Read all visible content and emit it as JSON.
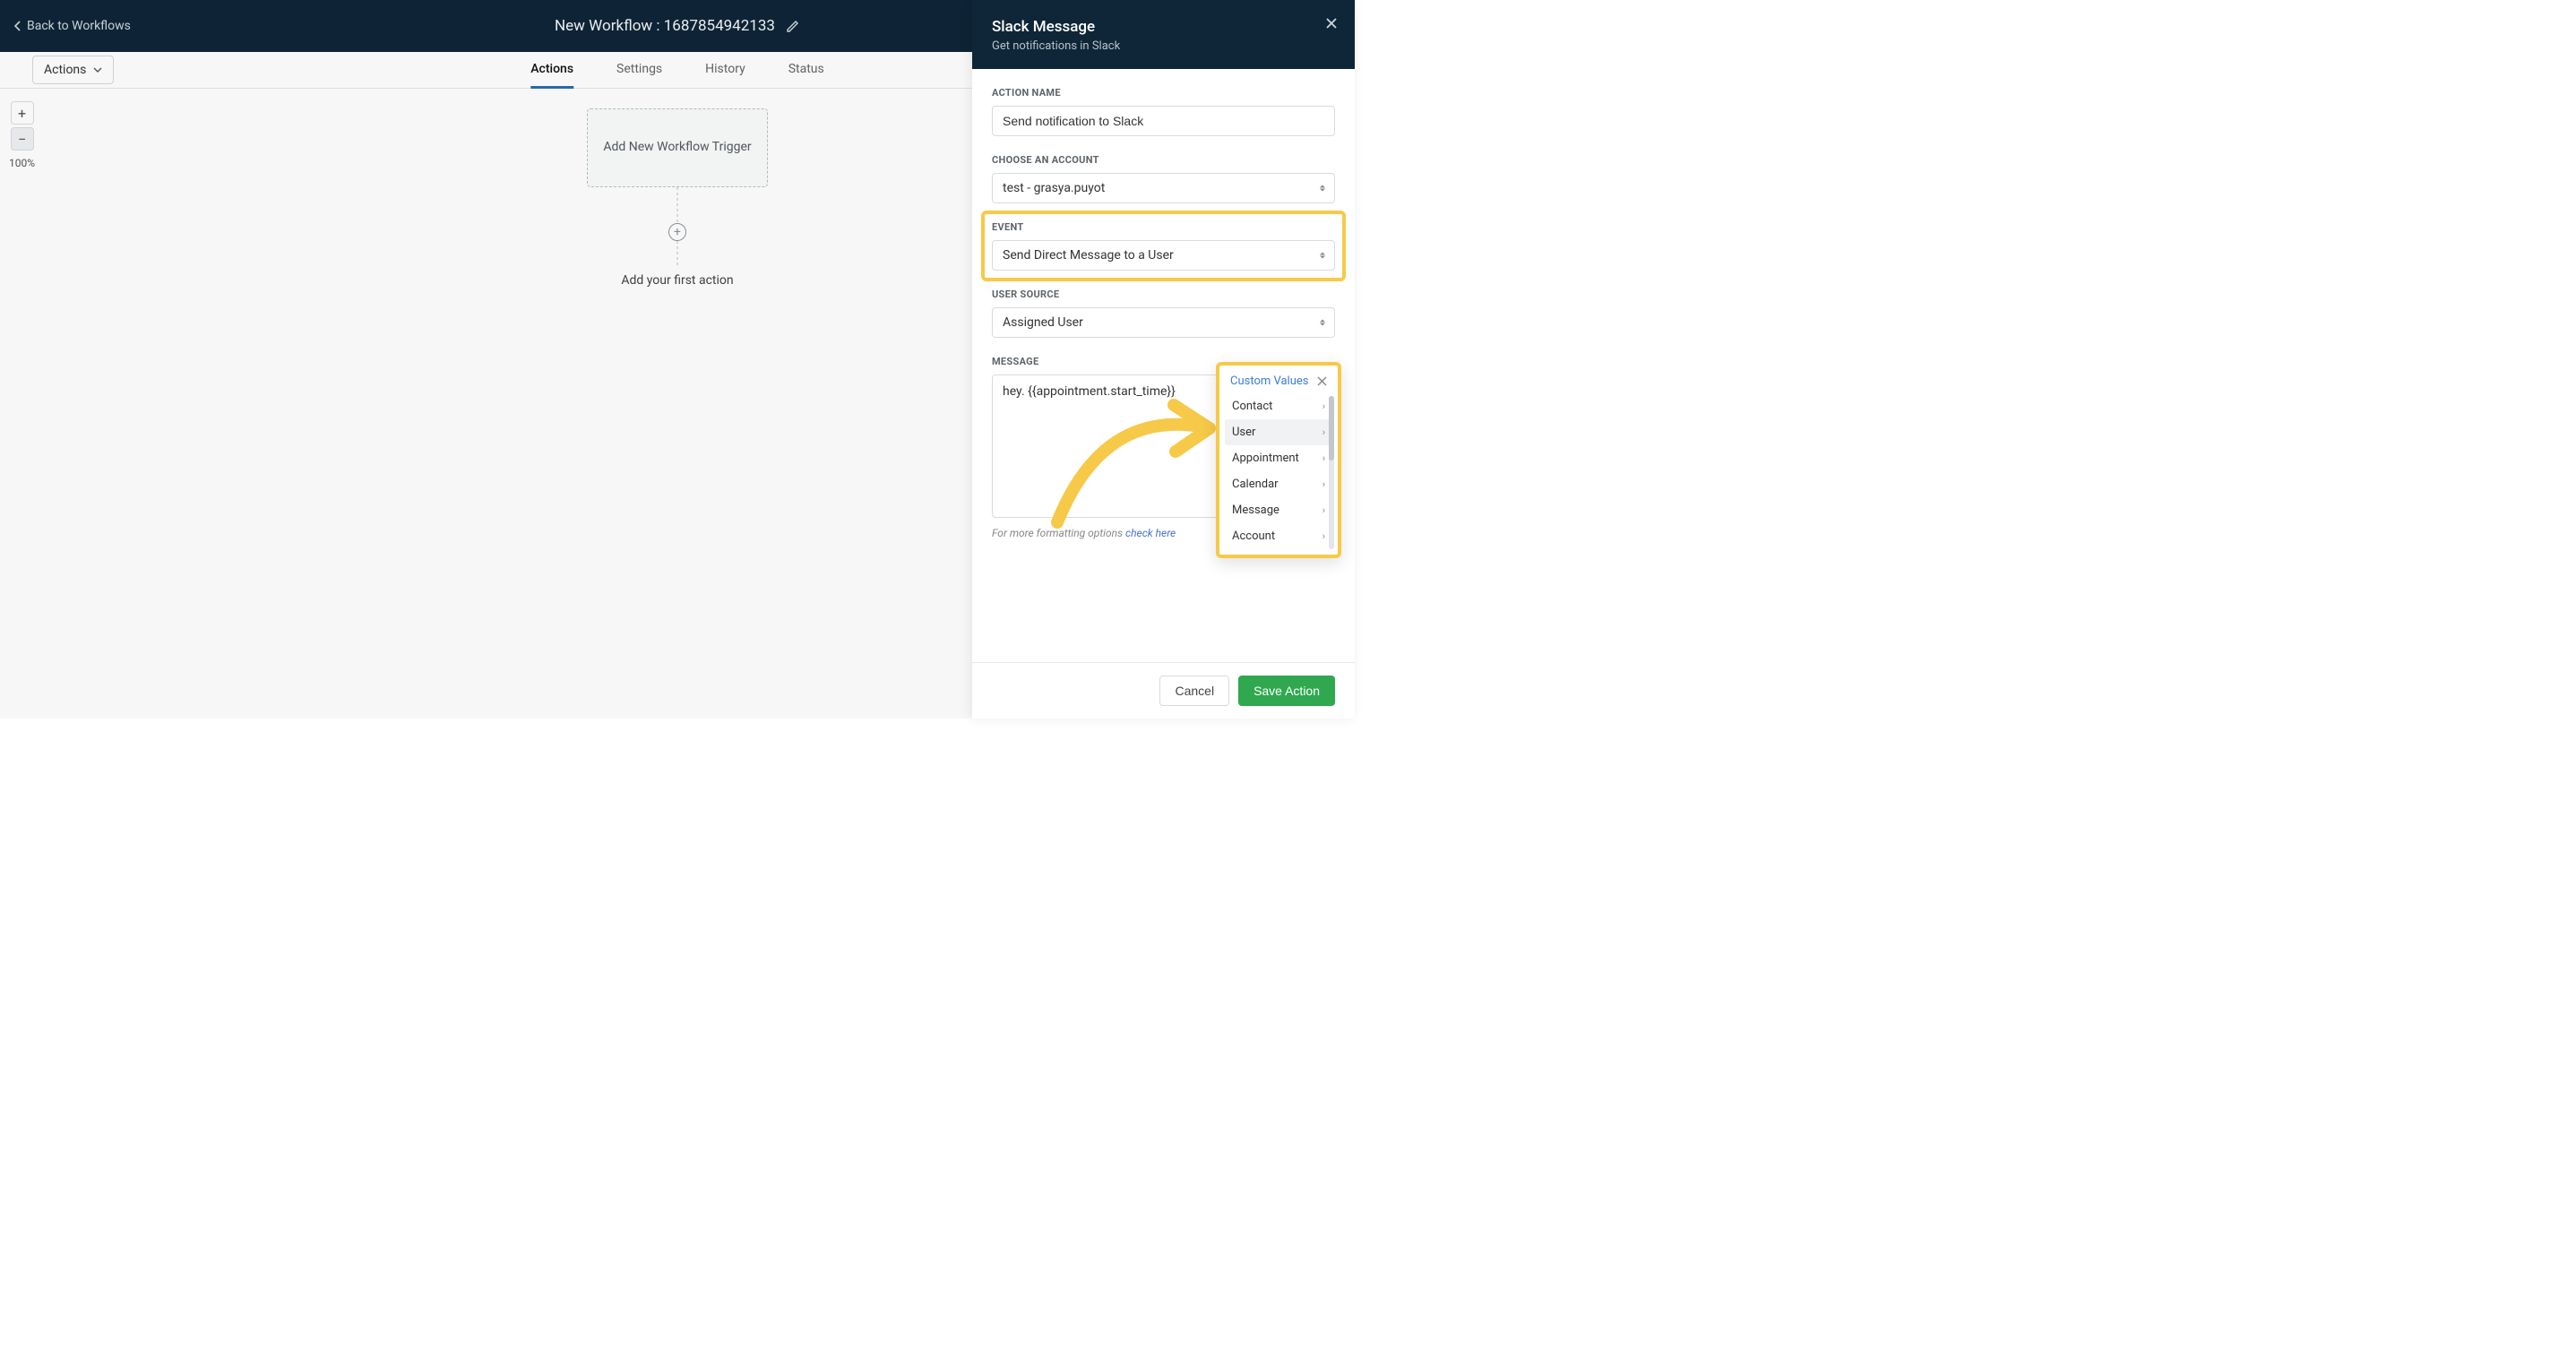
{
  "header": {
    "back_label": "Back to Workflows",
    "title": "New Workflow : 1687854942133"
  },
  "toolbar": {
    "actions_label": "Actions"
  },
  "tabs": {
    "actions": "Actions",
    "settings": "Settings",
    "history": "History",
    "status": "Status"
  },
  "zoom": {
    "level": "100%"
  },
  "canvas": {
    "trigger_label": "Add New Workflow Trigger",
    "add_action_label": "Add your first action"
  },
  "panel": {
    "title": "Slack Message",
    "subtitle": "Get notifications in Slack",
    "labels": {
      "action_name": "ACTION NAME",
      "choose_account": "CHOOSE AN ACCOUNT",
      "event": "EVENT",
      "user_source": "USER SOURCE",
      "message": "MESSAGE"
    },
    "values": {
      "action_name": "Send notification to Slack",
      "account": "test - grasya.puyot",
      "event": "Send Direct Message to a User",
      "user_source": "Assigned User",
      "message": "hey. {{appointment.start_time}}"
    },
    "help_prefix": "For more formatting options ",
    "help_link": "check here",
    "cancel": "Cancel",
    "save": "Save Action"
  },
  "popup": {
    "title": "Custom Values",
    "items": [
      "Contact",
      "User",
      "Appointment",
      "Calendar",
      "Message",
      "Account"
    ]
  }
}
